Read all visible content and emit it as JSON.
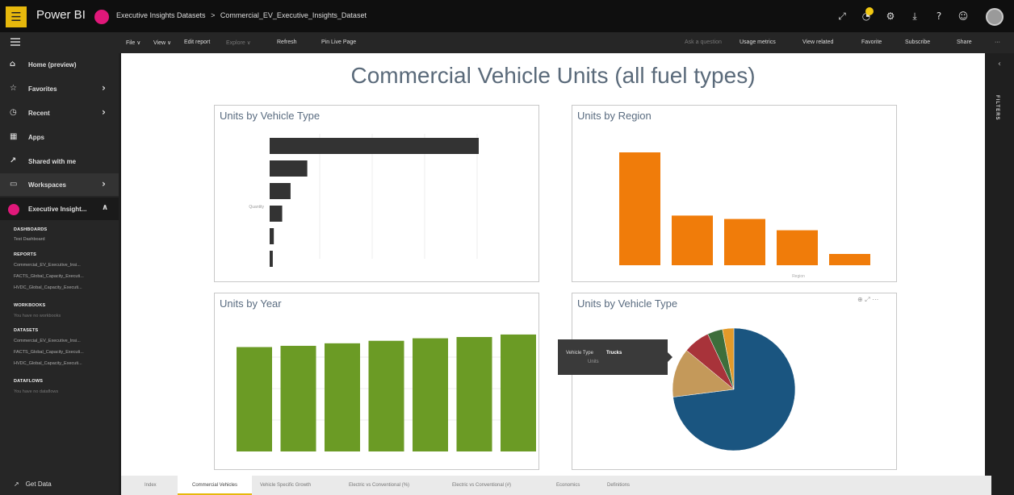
{
  "topbar": {
    "app_name": "Power BI",
    "breadcrumb": [
      "Executive Insights Datasets",
      ">",
      "Commercial_EV_Executive_Insights_Dataset"
    ],
    "icons": [
      "expand-icon",
      "notification-icon",
      "settings-icon",
      "download-icon",
      "help-icon",
      "feedback-icon"
    ]
  },
  "actionbar": {
    "file": "File ∨",
    "view": "View ∨",
    "edit_report": "Edit report",
    "explore": "Explore ∨",
    "refresh": "Refresh",
    "pin_live": "Pin Live Page",
    "ask_question": "Ask a question",
    "usage_metrics": "Usage metrics",
    "view_related": "View related",
    "favorite": "Favorite",
    "subscribe": "Subscribe",
    "share": "Share",
    "more": "···"
  },
  "sidebar": {
    "nav": [
      {
        "label": "Home (preview)",
        "icon": "home-icon"
      },
      {
        "label": "Favorites",
        "icon": "star-icon"
      },
      {
        "label": "Recent",
        "icon": "clock-icon"
      },
      {
        "label": "Apps",
        "icon": "apps-icon"
      },
      {
        "label": "Shared with me",
        "icon": "shared-icon"
      },
      {
        "label": "Workspaces",
        "icon": "workspaces-icon"
      },
      {
        "label": "Executive Insight...",
        "icon": "workspace-avatar"
      }
    ],
    "dashboards_header": "DASHBOARDS",
    "dashboards": [
      "Test Dashboard"
    ],
    "reports_header": "REPORTS",
    "reports": [
      "Commercial_EV_Executive_Insi...",
      "FACTS_Global_Capacity_Executi...",
      "HVDC_Global_Capacity_Executi..."
    ],
    "workbooks_header": "WORKBOOKS",
    "workbooks_empty": "You have no workbooks",
    "datasets_header": "DATASETS",
    "datasets": [
      "Commercial_EV_Executive_Insi...",
      "FACTS_Global_Capacity_Executi...",
      "HVDC_Global_Capacity_Executi..."
    ],
    "dataflows_header": "DATAFLOWS",
    "dataflows_empty": "You have no dataflows",
    "get_data": "Get Data"
  },
  "filters_label": "FILTERS",
  "report": {
    "title": "Commercial Vehicle Units (all fuel types)"
  },
  "visuals": {
    "vehicle_type_bar_title": "Units by Vehicle Type",
    "region_title": "Units by Region",
    "year_title": "Units by Year",
    "vehicle_type_pie_title": "Units by Vehicle Type"
  },
  "tooltip": {
    "vehicle_type_label": "Vehicle Type",
    "vehicle_type_value": "Trucks",
    "units_label": "Units"
  },
  "tabs": [
    "Index",
    "Commercial Vehicles",
    "Vehicle Specific Growth",
    "Electric vs Conventional (%)",
    "Electric vs Conventional (#)",
    "Economics",
    "Definitions"
  ],
  "active_tab": "Commercial Vehicles",
  "colors": {
    "bar_dark": "#333333",
    "region_orange": "#f07c0a",
    "year_green": "#6b9b25",
    "pie": [
      "#1a5580",
      "#c4995a",
      "#a8333a",
      "#3d6e3b",
      "#e29a2a"
    ],
    "accent": "#e6b80c"
  },
  "chart_data": [
    {
      "type": "bar",
      "orientation": "horizontal",
      "title": "Units by Vehicle Type",
      "categories": [
        "",
        "",
        "",
        "",
        "",
        ""
      ],
      "values": [
        100,
        18,
        10,
        6,
        2,
        1.5
      ],
      "annotation": "Quantity",
      "grid": true
    },
    {
      "type": "bar",
      "title": "Units by Region",
      "categories": [
        "",
        "",
        "",
        "",
        ""
      ],
      "values": [
        100,
        44,
        41,
        31,
        10
      ],
      "annotation": "Region",
      "grid": false
    },
    {
      "type": "bar",
      "title": "Units by Year",
      "categories": [
        "",
        "",
        "",
        "",
        "",
        "",
        ""
      ],
      "values": [
        83,
        84,
        86,
        88,
        90,
        91,
        93
      ],
      "ylim": [
        0,
        100
      ],
      "grid": true
    },
    {
      "type": "pie",
      "title": "Units by Vehicle Type",
      "labels": [
        "Trucks",
        "",
        "",
        "",
        ""
      ],
      "values": [
        73,
        13,
        7,
        4,
        3
      ]
    }
  ]
}
